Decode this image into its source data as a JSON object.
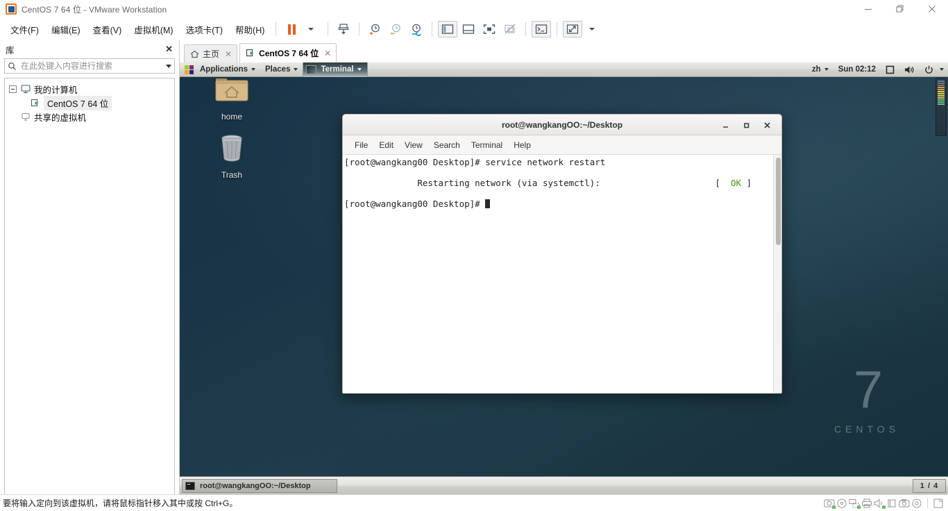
{
  "window": {
    "title": "CentOS 7 64 位 - VMware Workstation",
    "app_icon": "vmware-logo-icon",
    "controls": {
      "minimize": "minimize-icon",
      "maximize": "restore-icon",
      "close": "close-icon"
    }
  },
  "menubar": {
    "items": [
      {
        "label": "文件(F)"
      },
      {
        "label": "编辑(E)"
      },
      {
        "label": "查看(V)"
      },
      {
        "label": "虚拟机(M)"
      },
      {
        "label": "选项卡(T)"
      },
      {
        "label": "帮助(H)"
      }
    ],
    "toolbar": [
      {
        "name": "suspend-button",
        "icon": "pause-icon"
      },
      {
        "name": "power-dropdown",
        "icon": "chevron-down-icon"
      },
      {
        "name": "manage-snapshot-button",
        "icon": "snapshot-icon"
      },
      {
        "name": "take-snapshot-button",
        "icon": "clock-plus-icon"
      },
      {
        "name": "revert-snapshot-button",
        "icon": "clock-back-icon"
      },
      {
        "name": "snapshot-manager-button",
        "icon": "clock-wrench-icon"
      },
      {
        "name": "show-library-button",
        "icon": "panel-left-icon"
      },
      {
        "name": "show-thumbnail-bar-button",
        "icon": "panel-bottom-icon"
      },
      {
        "name": "enter-fullscreen-button",
        "icon": "fullscreen-icon"
      },
      {
        "name": "unity-mode-button",
        "icon": "unity-off-icon"
      },
      {
        "name": "console-view-button",
        "icon": "console-icon"
      },
      {
        "name": "stretch-guest-button",
        "icon": "expand-arrows-icon"
      },
      {
        "name": "stretch-dropdown",
        "icon": "chevron-down-icon"
      }
    ]
  },
  "sidebar": {
    "title": "库",
    "close_icon": "close-icon",
    "search": {
      "placeholder": "在此处键入内容进行搜索",
      "value": "",
      "icon": "search-icon",
      "dropdown_icon": "chevron-down-icon"
    },
    "tree": [
      {
        "label": "我的计算机",
        "icon": "computer-icon",
        "level": 0,
        "expanded": true,
        "selected": false
      },
      {
        "label": "CentOS 7 64 位",
        "icon": "vm-running-icon",
        "level": 1,
        "expanded": false,
        "selected": true
      },
      {
        "label": "共享的虚拟机",
        "icon": "shared-vm-icon",
        "level": 0,
        "expanded": false,
        "selected": false
      }
    ]
  },
  "tabs": [
    {
      "label": "主页",
      "icon": "home-icon",
      "active": false,
      "close_icon": "close-icon"
    },
    {
      "label": "CentOS 7 64 位",
      "icon": "vm-running-icon",
      "active": true,
      "close_icon": "close-icon"
    }
  ],
  "guest": {
    "gnome_panel": {
      "applications": "Applications",
      "places": "Places",
      "active_window": "Terminal",
      "logo_icon": "centos-foot-icon",
      "caret_icon": "chevron-down-icon",
      "keyboard_layout": "zh",
      "clock": "Sun 02:12",
      "tray": [
        {
          "name": "notifications-icon",
          "icon": "square-icon"
        },
        {
          "name": "volume-icon",
          "icon": "speaker-icon"
        },
        {
          "name": "power-menu-icon",
          "icon": "power-icon"
        },
        {
          "name": "menu-caret-icon",
          "icon": "chevron-down-icon"
        }
      ]
    },
    "desktop_icons": [
      {
        "label": "home",
        "icon": "home-folder-icon"
      },
      {
        "label": "Trash",
        "icon": "trash-icon"
      }
    ],
    "watermark": {
      "number": "7",
      "name": "CENTOS"
    },
    "taskbar": {
      "window_button": {
        "label": "root@wangkangOO:~/Desktop",
        "icon": "terminal-icon"
      },
      "workspace_indicator": "1 / 4"
    }
  },
  "terminal": {
    "title": "root@wangkangOO:~/Desktop",
    "controls": {
      "minimize": "minimize-icon",
      "maximize": "maximize-icon",
      "close": "close-icon"
    },
    "menu": [
      "File",
      "Edit",
      "View",
      "Search",
      "Terminal",
      "Help"
    ],
    "lines": [
      {
        "text": "[root@wangkang00 Desktop]# service network restart"
      },
      {
        "prefix": "Restarting network (via systemctl):",
        "status": "OK",
        "bracket_open": "[",
        "bracket_close": "]"
      },
      {
        "text": "[root@wangkang00 Desktop]# ",
        "cursor": true
      }
    ],
    "status_color": "#4e9a06"
  },
  "statusbar": {
    "message": "要将输入定向到该虚拟机，请将鼠标指针移入其中或按 Ctrl+G。",
    "devices": [
      {
        "name": "hard-disk-icon"
      },
      {
        "name": "cd-dvd-icon"
      },
      {
        "name": "network-adapter-icon"
      },
      {
        "name": "printer-icon"
      },
      {
        "name": "sound-card-icon"
      },
      {
        "name": "usb-controller-icon"
      },
      {
        "name": "camera-icon"
      },
      {
        "name": "floppy-icon"
      },
      {
        "name": "display-icon"
      }
    ]
  },
  "colors": {
    "accent_orange": "#e8601c",
    "vm_logo_blue": "#1f5c8b",
    "terminal_ok_green": "#4e9a06",
    "desktop_bg": "#1a3547"
  }
}
